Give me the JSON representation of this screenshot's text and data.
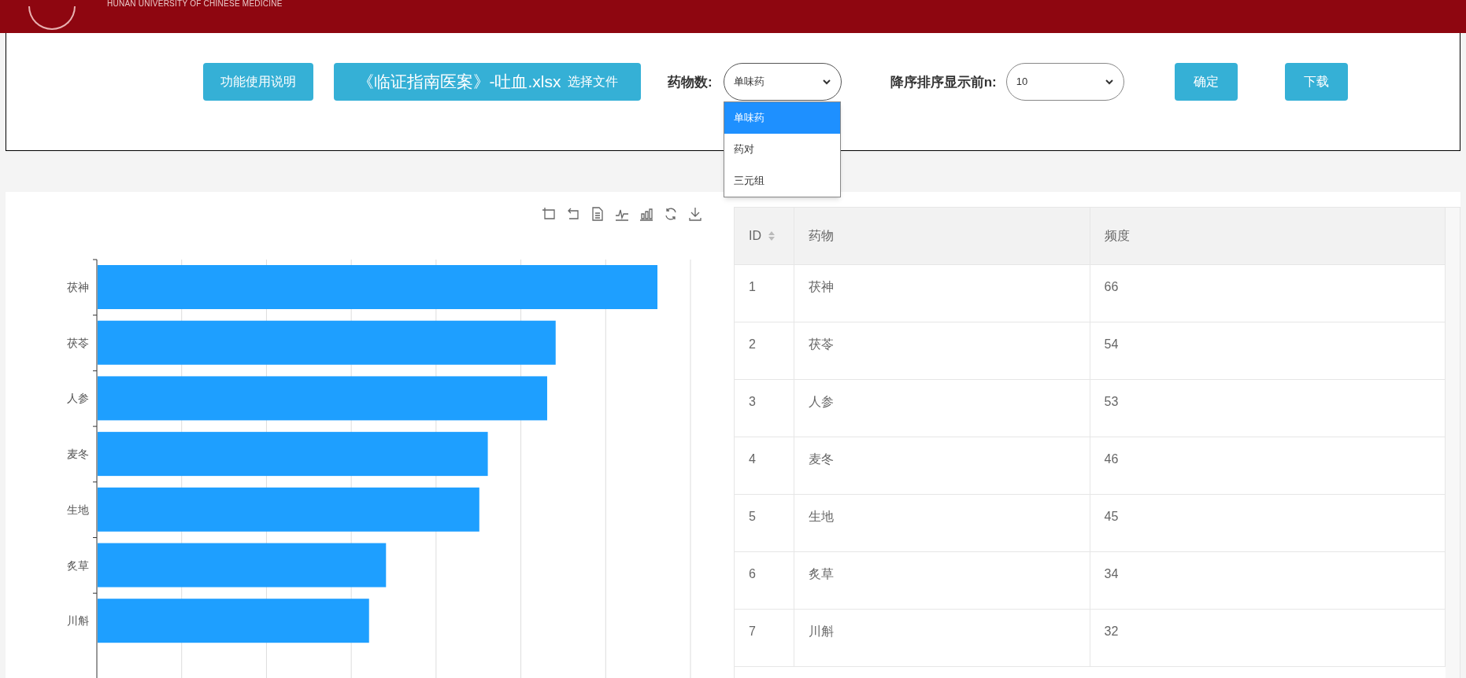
{
  "header": {
    "subtitle": "HUNAN UNIVERSITY OF CHINESE MEDICINE"
  },
  "toolbar": {
    "help_button": "功能使用说明",
    "file_button": {
      "filename": "《临证指南医案》-吐血.xlsx",
      "label": "选择文件"
    },
    "herb_count": {
      "label": "药物数:",
      "value": "单味药",
      "expanded": true,
      "options": [
        {
          "label": "单味药",
          "selected": true
        },
        {
          "label": "药对",
          "selected": false
        },
        {
          "label": "三元组",
          "selected": false
        }
      ]
    },
    "top_n": {
      "label": "降序排序显示前n:",
      "value": "10"
    },
    "confirm_button": "确定",
    "download_button": "下载"
  },
  "chart": {
    "category_labels": [
      "茯神",
      "茯苓",
      "人参",
      "麦冬",
      "生地",
      "炙草",
      "川斛"
    ]
  },
  "table": {
    "columns": [
      "ID",
      "药物",
      "频度"
    ],
    "rows": [
      [
        "1",
        "茯神",
        "66"
      ],
      [
        "2",
        "茯苓",
        "54"
      ],
      [
        "3",
        "人参",
        "53"
      ],
      [
        "4",
        "麦冬",
        "46"
      ],
      [
        "5",
        "生地",
        "45"
      ],
      [
        "6",
        "炙草",
        "34"
      ],
      [
        "7",
        "川斛",
        "32"
      ]
    ]
  }
}
